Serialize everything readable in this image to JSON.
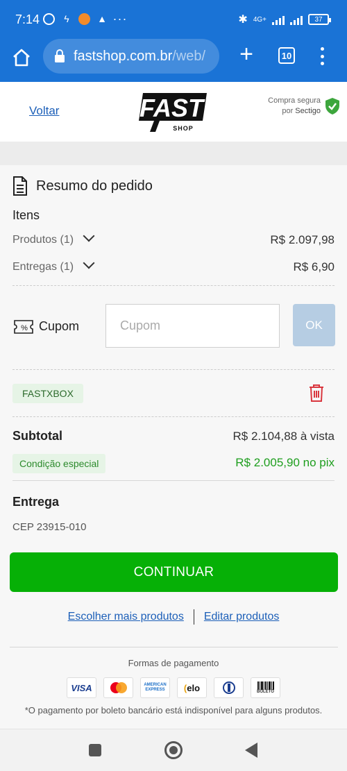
{
  "status": {
    "time": "7:14",
    "network": "4G+",
    "battery": "37"
  },
  "browser": {
    "url_host": "fastshop.com.br",
    "url_path": "/web/",
    "tab_count": "10"
  },
  "header": {
    "back_link": "Voltar",
    "logo_text": "FAST",
    "logo_sub": "SHOP",
    "secure_line1": "Compra segura",
    "secure_by": "por",
    "secure_brand": "Sectigo"
  },
  "summary": {
    "title": "Resumo do pedido",
    "items_heading": "Itens",
    "products_label": "Produtos (1)",
    "products_value": "R$ 2.097,98",
    "delivery_label": "Entregas (1)",
    "delivery_value": "R$ 6,90"
  },
  "coupon": {
    "label": "Cupom",
    "placeholder": "Cupom",
    "ok_label": "OK",
    "applied_code": "FASTXBOX"
  },
  "totals": {
    "subtotal_label": "Subtotal",
    "subtotal_value": "R$ 2.104,88 à vista",
    "special_label": "Condição especial",
    "pix_value": "R$ 2.005,90 no pix"
  },
  "shipping": {
    "heading": "Entrega",
    "cep": "CEP 23915-010"
  },
  "actions": {
    "continue_label": "CONTINUAR",
    "more_products": "Escolher mais produtos",
    "edit_products": "Editar produtos"
  },
  "payment": {
    "title": "Formas de pagamento",
    "cards": [
      "VISA",
      "mastercard",
      "AMERICAN EXPRESS",
      "elo",
      "diners",
      "BOLETO"
    ],
    "note": "*O pagamento por boleto bancário está indisponível para alguns produtos."
  },
  "colors": {
    "primary": "#1a73d6",
    "continue": "#06b006",
    "pix": "#1e9e1e",
    "ok_disabled": "#b6cde3",
    "trash": "#d9363e"
  }
}
